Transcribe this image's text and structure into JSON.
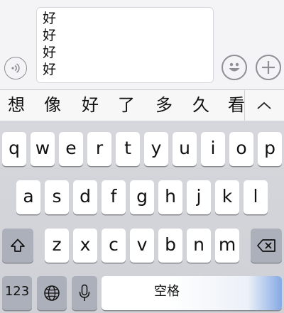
{
  "message_input": {
    "lines": [
      "好",
      "好",
      "好",
      "好"
    ]
  },
  "icons": {
    "voice": "voice-icon",
    "emoji": "emoji-icon",
    "plus": "plus-icon",
    "collapse": "chevron-up-icon",
    "shift": "shift-icon",
    "delete": "backspace-icon",
    "globe": "globe-icon",
    "mic": "microphone-icon"
  },
  "candidates": [
    "想",
    "像",
    "好",
    "了",
    "多",
    "久",
    "看"
  ],
  "keyboard": {
    "row1": [
      "q",
      "w",
      "e",
      "r",
      "t",
      "y",
      "u",
      "i",
      "o",
      "p"
    ],
    "row2": [
      "a",
      "s",
      "d",
      "f",
      "g",
      "h",
      "j",
      "k",
      "l"
    ],
    "row3": [
      "z",
      "x",
      "c",
      "v",
      "b",
      "n",
      "m"
    ],
    "numbers_label": "123",
    "space_label": "空格"
  },
  "colors": {
    "keyboard_bg": "#d2d4d9",
    "key_bg": "#ffffff",
    "function_key_bg": "#abb0ba",
    "accent_glow": "#78a0e1"
  }
}
